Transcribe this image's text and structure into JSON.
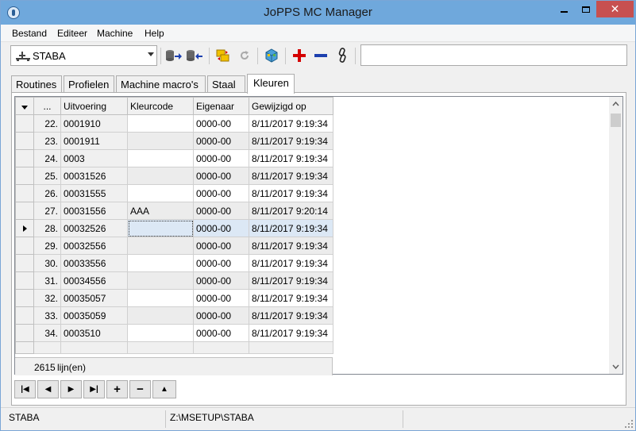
{
  "window": {
    "title": "JoPPS MC Manager",
    "close_glyph": "✕"
  },
  "menu": {
    "items": [
      "Bestand",
      "Editeer",
      "Machine",
      "Help"
    ]
  },
  "toolbar": {
    "machine": "STABA",
    "machine_icon": "machine-icon",
    "buttons": [
      {
        "name": "export-db-icon"
      },
      {
        "name": "import-db-icon"
      },
      {
        "name": "copy-folder-icon"
      },
      {
        "name": "refresh-icon"
      },
      {
        "name": "cube-box-icon"
      },
      {
        "name": "add-icon"
      },
      {
        "name": "remove-icon"
      },
      {
        "name": "link-chain-icon"
      }
    ],
    "search_value": ""
  },
  "tabs": {
    "items": [
      "Routines",
      "Profielen",
      "Machine macro's",
      "Staal",
      "Kleuren"
    ],
    "active": "Kleuren"
  },
  "grid": {
    "columns": {
      "num": "...",
      "uitvoering": "Uitvoering",
      "kleurcode": "Kleurcode",
      "eigenaar": "Eigenaar",
      "gewijzigd": "Gewijzigd op"
    },
    "rows": [
      {
        "num": "22.",
        "uitvoering": "0001910",
        "kleurcode": "",
        "eigenaar": "0000-00",
        "gewijzigd": "8/11/2017 9:19:34"
      },
      {
        "num": "23.",
        "uitvoering": "0001911",
        "kleurcode": "",
        "eigenaar": "0000-00",
        "gewijzigd": "8/11/2017 9:19:34"
      },
      {
        "num": "24.",
        "uitvoering": "0003",
        "kleurcode": "",
        "eigenaar": "0000-00",
        "gewijzigd": "8/11/2017 9:19:34"
      },
      {
        "num": "25.",
        "uitvoering": "00031526",
        "kleurcode": "",
        "eigenaar": "0000-00",
        "gewijzigd": "8/11/2017 9:19:34"
      },
      {
        "num": "26.",
        "uitvoering": "00031555",
        "kleurcode": "",
        "eigenaar": "0000-00",
        "gewijzigd": "8/11/2017 9:19:34"
      },
      {
        "num": "27.",
        "uitvoering": "00031556",
        "kleurcode": "AAA",
        "eigenaar": "0000-00",
        "gewijzigd": "8/11/2017 9:20:14"
      },
      {
        "num": "28.",
        "uitvoering": "00032526",
        "kleurcode": "",
        "eigenaar": "0000-00",
        "gewijzigd": "8/11/2017 9:19:34"
      },
      {
        "num": "29.",
        "uitvoering": "00032556",
        "kleurcode": "",
        "eigenaar": "0000-00",
        "gewijzigd": "8/11/2017 9:19:34"
      },
      {
        "num": "30.",
        "uitvoering": "00033556",
        "kleurcode": "",
        "eigenaar": "0000-00",
        "gewijzigd": "8/11/2017 9:19:34"
      },
      {
        "num": "31.",
        "uitvoering": "00034556",
        "kleurcode": "",
        "eigenaar": "0000-00",
        "gewijzigd": "8/11/2017 9:19:34"
      },
      {
        "num": "32.",
        "uitvoering": "00035057",
        "kleurcode": "",
        "eigenaar": "0000-00",
        "gewijzigd": "8/11/2017 9:19:34"
      },
      {
        "num": "33.",
        "uitvoering": "00035059",
        "kleurcode": "",
        "eigenaar": "0000-00",
        "gewijzigd": "8/11/2017 9:19:34"
      },
      {
        "num": "34.",
        "uitvoering": "0003510",
        "kleurcode": "",
        "eigenaar": "0000-00",
        "gewijzigd": "8/11/2017 9:19:34"
      }
    ],
    "current_row": "28.",
    "count": "2615",
    "count_unit": "lijn(en)"
  },
  "navigator": {
    "buttons": [
      {
        "name": "first-record-button",
        "glyph": "|◀"
      },
      {
        "name": "prev-record-button",
        "glyph": "◀"
      },
      {
        "name": "next-record-button",
        "glyph": "▶"
      },
      {
        "name": "last-record-button",
        "glyph": "▶|"
      },
      {
        "name": "add-record-button",
        "glyph": "+"
      },
      {
        "name": "delete-record-button",
        "glyph": "−"
      },
      {
        "name": "post-record-button",
        "glyph": "▲"
      }
    ]
  },
  "status": {
    "machine": "STABA",
    "path": "Z:\\MSETUP\\STABA",
    "extra": ""
  },
  "colors": {
    "titlebar": "#6fa8dc",
    "close_button": "#c75050",
    "selection": "#dce8f5",
    "add_red": "#d40000",
    "remove_blue": "#1c3fae"
  }
}
